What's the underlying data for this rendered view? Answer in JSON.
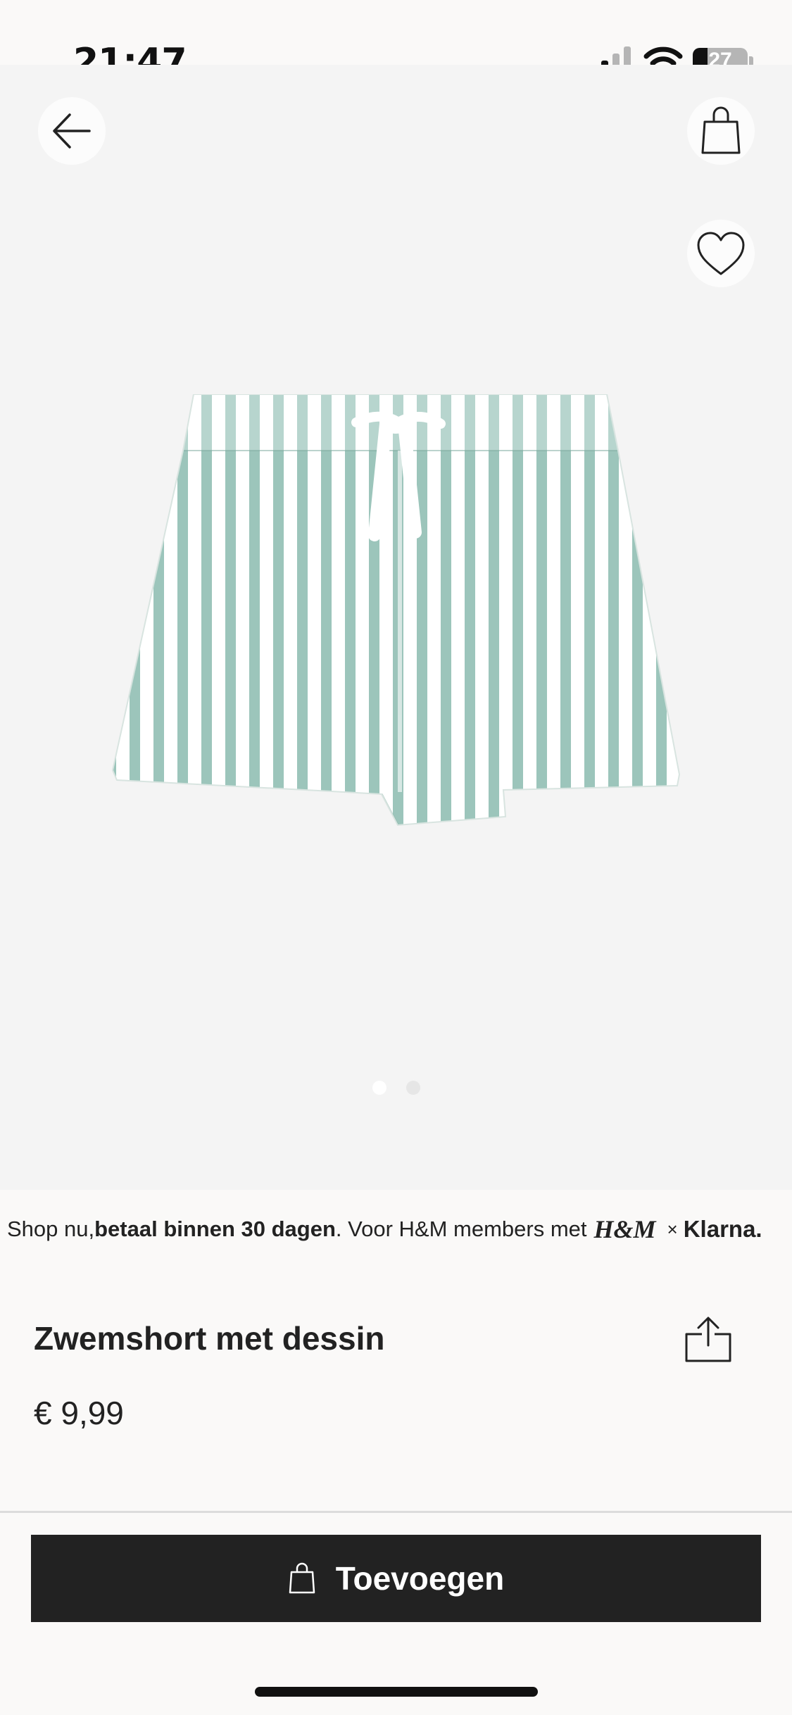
{
  "status_bar": {
    "time": "21:47",
    "battery_level": "27",
    "battery_fraction": 0.27
  },
  "header": {
    "back_icon": "arrow-left-icon",
    "bag_icon": "shopping-bag-icon",
    "favorite_icon": "heart-icon"
  },
  "gallery": {
    "image_description_icon": "striped-swim-shorts",
    "pages_total": 2,
    "active_page": 1,
    "stripe_color": "#9cc5bb"
  },
  "klarna_banner": {
    "part1": "Shop nu, ",
    "bold": "betaal binnen 30 dagen",
    "part2": ". Voor H&M members met ",
    "hm_logo": "H&M",
    "times": "×",
    "klarna_logo": "Klarna."
  },
  "product": {
    "title": "Zwemshort met dessin",
    "price": "€ 9,99",
    "share_icon": "share-icon"
  },
  "cta": {
    "label": "Toevoegen",
    "icon": "shopping-bag-icon",
    "color": "#222222"
  }
}
